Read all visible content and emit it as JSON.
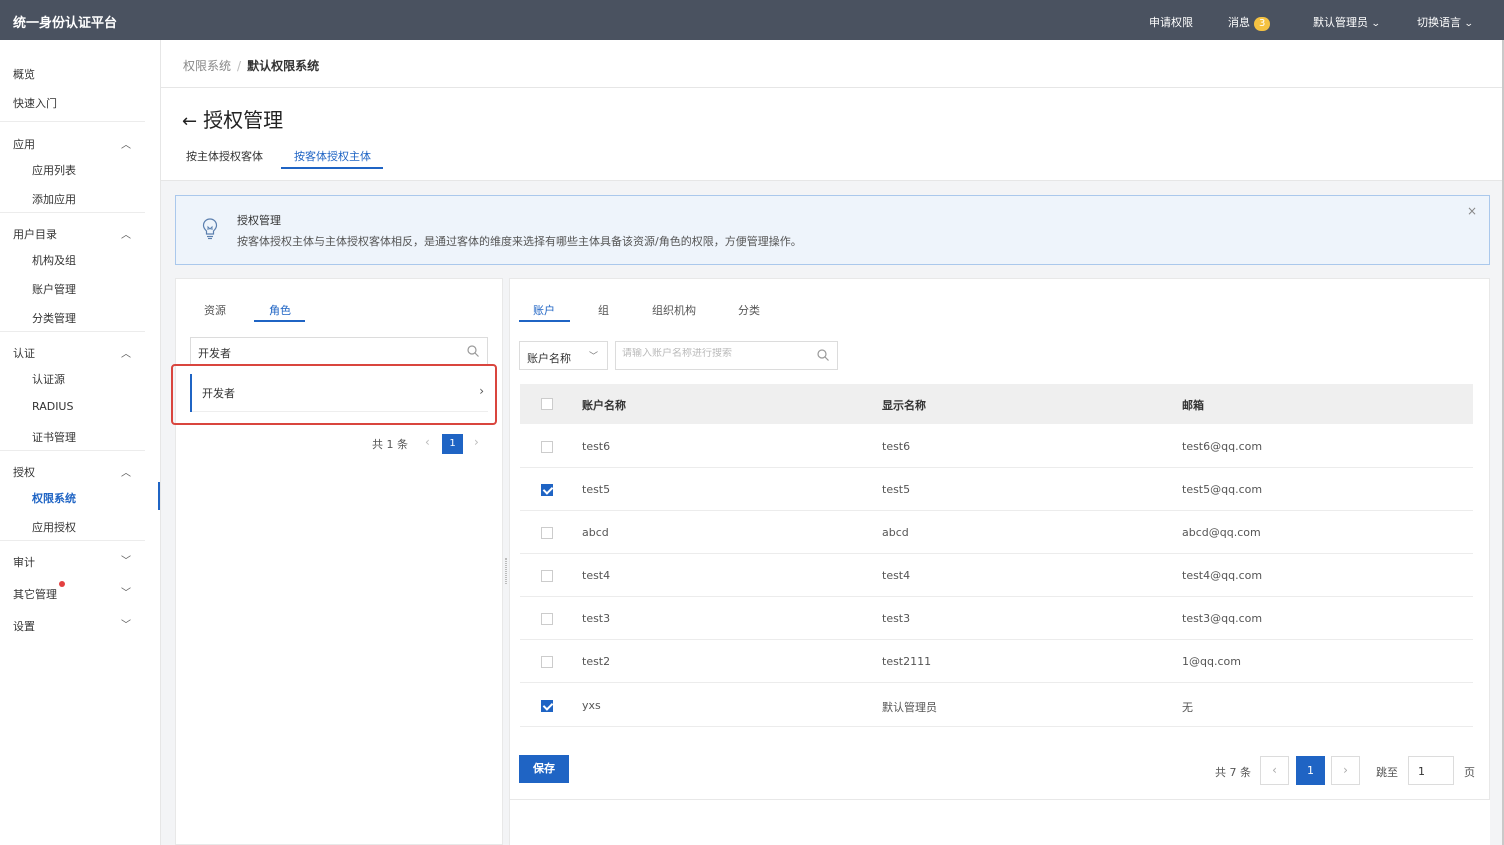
{
  "header": {
    "brand": "统一身份认证平台",
    "apply_permission": "申请权限",
    "messages_label": "消息",
    "messages_count": "3",
    "user": "默认管理员",
    "language": "切换语言"
  },
  "sidebar": {
    "overview": "概览",
    "quickstart": "快速入门",
    "apps": {
      "label": "应用",
      "items": [
        "应用列表",
        "添加应用"
      ]
    },
    "directory": {
      "label": "用户目录",
      "items": [
        "机构及组",
        "账户管理",
        "分类管理"
      ]
    },
    "auth": {
      "label": "认证",
      "items": [
        "认证源",
        "RADIUS",
        "证书管理"
      ]
    },
    "authorization": {
      "label": "授权",
      "items": [
        "权限系统",
        "应用授权"
      ]
    },
    "audit": "审计",
    "other": "其它管理",
    "settings": "设置"
  },
  "breadcrumb": {
    "parent": "权限系统",
    "sep": "/",
    "current": "默认权限系统"
  },
  "page": {
    "back_arrow": "←",
    "title": "授权管理",
    "tabs": [
      "按主体授权客体",
      "按客体授权主体"
    ]
  },
  "alert": {
    "title": "授权管理",
    "desc": "按客体授权主体与主体授权客体相反，是通过客体的维度来选择有哪些主体具备该资源/角色的权限，方便管理操作。",
    "close": "×"
  },
  "left": {
    "tabs": [
      "资源",
      "角色"
    ],
    "search_value": "开发者",
    "items": [
      "开发者"
    ],
    "total": "共 1 条",
    "page": "1",
    "prev": "‹",
    "next": "›"
  },
  "right": {
    "tabs": [
      "账户",
      "组",
      "组织机构",
      "分类"
    ],
    "filter_select": "账户名称",
    "search_placeholder": "请输入账户名称进行搜索",
    "columns": [
      "账户名称",
      "显示名称",
      "邮箱"
    ],
    "rows": [
      {
        "account": "test6",
        "display": "test6",
        "email": "test6@qq.com",
        "checked": false
      },
      {
        "account": "test5",
        "display": "test5",
        "email": "test5@qq.com",
        "checked": true
      },
      {
        "account": "abcd",
        "display": "abcd",
        "email": "abcd@qq.com",
        "checked": false
      },
      {
        "account": "test4",
        "display": "test4",
        "email": "test4@qq.com",
        "checked": false
      },
      {
        "account": "test3",
        "display": "test3",
        "email": "test3@qq.com",
        "checked": false
      },
      {
        "account": "test2",
        "display": "test2111",
        "email": "1@qq.com",
        "checked": false
      },
      {
        "account": "yxs",
        "display": "默认管理员",
        "email": "无",
        "checked": true
      }
    ],
    "save": "保存",
    "total": "共 7 条",
    "page": "1",
    "jump_label": "跳至",
    "jump_value": "1",
    "page_suffix": "页",
    "prev": "‹",
    "next": "›"
  },
  "colors": {
    "primary": "#1f64c4",
    "topbar": "#4a5260",
    "highlight_border": "#d9453e",
    "badge": "#f5c242"
  }
}
